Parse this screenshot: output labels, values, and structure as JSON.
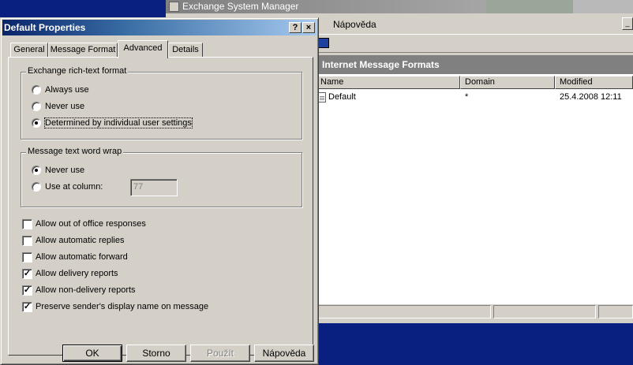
{
  "background_window": {
    "title": "Exchange System Manager",
    "menu": [
      "Nápověda"
    ],
    "panel_title": "Internet Message Formats",
    "columns": [
      "Name",
      "Domain",
      "Modified"
    ],
    "rows": [
      {
        "name": "Default",
        "domain": "*",
        "modified": "25.4.2008 12:11"
      }
    ]
  },
  "dialog": {
    "title": "Default Properties",
    "help_btn": "?",
    "close_btn": "×",
    "tabs": [
      {
        "label": "General",
        "active": false
      },
      {
        "label": "Message Format",
        "active": false
      },
      {
        "label": "Advanced",
        "active": true
      },
      {
        "label": "Details",
        "active": false
      }
    ],
    "rich_text_group": {
      "label": "Exchange rich-text format",
      "options": [
        {
          "label": "Always use",
          "checked": false
        },
        {
          "label": "Never use",
          "checked": false
        },
        {
          "label": "Determined by individual user settings",
          "checked": true
        }
      ]
    },
    "word_wrap_group": {
      "label": "Message text word wrap",
      "options": [
        {
          "label": "Never use",
          "checked": true
        },
        {
          "label": "Use at column:",
          "checked": false
        }
      ],
      "column_value": "77"
    },
    "checkboxes": [
      {
        "label": "Allow out of office responses",
        "checked": false
      },
      {
        "label": "Allow automatic replies",
        "checked": false
      },
      {
        "label": "Allow automatic forward",
        "checked": false
      },
      {
        "label": "Allow delivery reports",
        "checked": true
      },
      {
        "label": "Allow non-delivery reports",
        "checked": true
      },
      {
        "label": "Preserve sender's display name on message",
        "checked": true
      }
    ],
    "buttons": {
      "ok": "OK",
      "cancel": "Storno",
      "apply": "Použít",
      "help": "Nápověda"
    }
  },
  "colors": {
    "dialog_title_start": "#0a246a",
    "dialog_title_end": "#a6caf0",
    "desktop": "#0a2080",
    "face": "#d4d0c8"
  }
}
